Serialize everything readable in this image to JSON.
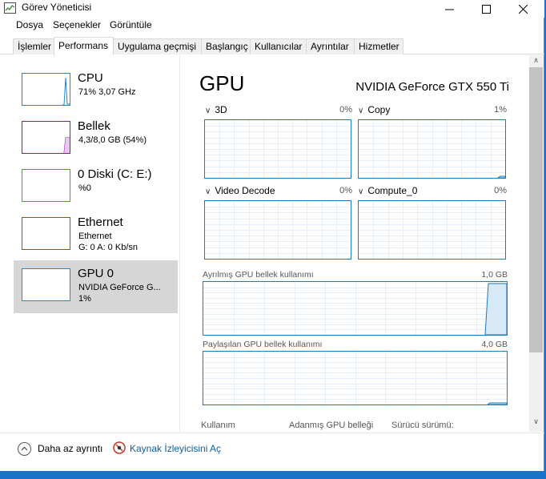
{
  "window": {
    "title": "Görev Yöneticisi"
  },
  "menu": [
    "Dosya",
    "Seçenekler",
    "Görüntüle"
  ],
  "tabs": [
    {
      "label": "İşlemler",
      "active": false
    },
    {
      "label": "Performans",
      "active": true
    },
    {
      "label": "Uygulama geçmişi",
      "active": false
    },
    {
      "label": "Başlangıç",
      "active": false
    },
    {
      "label": "Kullanıcılar",
      "active": false
    },
    {
      "label": "Ayrıntılar",
      "active": false
    },
    {
      "label": "Hizmetler",
      "active": false
    }
  ],
  "sidebar": {
    "items": [
      {
        "title": "CPU",
        "line1": "71% 3,07 GHz",
        "line2": "",
        "color": "#1a8ad4",
        "selected": false
      },
      {
        "title": "Bellek",
        "line1": "4,3/8,0 GB (54%)",
        "line2": "",
        "color": "#8b12ae",
        "selected": false
      },
      {
        "title": "0 Diski (C: E:)",
        "line1": "%0",
        "line2": "",
        "color": "#4da60c",
        "selected": false
      },
      {
        "title": "Ethernet",
        "line1": "Ethernet",
        "line2": "G: 0 A: 0 Kb/sn",
        "color": "#a74f01",
        "selected": false
      },
      {
        "title": "GPU 0",
        "line1": "NVIDIA GeForce G...",
        "line2": "1%",
        "color": "#1a8ad4",
        "selected": true
      }
    ]
  },
  "main": {
    "title": "GPU",
    "gpu_name": "NVIDIA GeForce GTX 550 Ti",
    "engines": [
      {
        "label": "3D",
        "percent": "0%"
      },
      {
        "label": "Copy",
        "percent": "1%"
      },
      {
        "label": "Video Decode",
        "percent": "0%"
      },
      {
        "label": "Compute_0",
        "percent": "0%"
      }
    ],
    "dedicated_memory": {
      "label": "Ayrılmış GPU bellek kullanımı",
      "max": "1,0 GB"
    },
    "shared_memory": {
      "label": "Paylaşılan GPU bellek kullanımı",
      "max": "4,0 GB"
    },
    "stats": [
      "Kullanım",
      "Adanmış GPU belleği",
      "Sürücü sürümü:"
    ]
  },
  "footer": {
    "fewer_details": "Daha az ayrıntı",
    "resource_monitor": "Kaynak İzleyicisini Aç"
  },
  "colors": {
    "accent": "#1a72c9",
    "graph_border": "#1b7ab8",
    "selected_bg": "#d6d6d6"
  }
}
